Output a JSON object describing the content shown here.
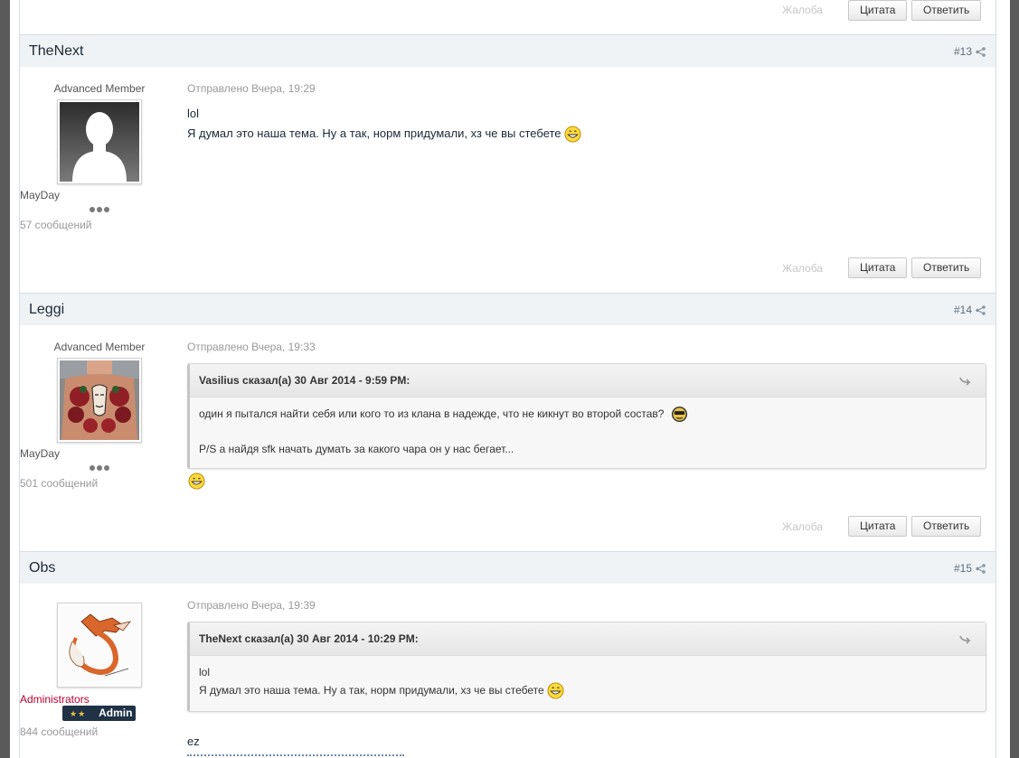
{
  "common": {
    "report_label": "Жалоба",
    "quote_label": "Цитата",
    "reply_label": "Ответить"
  },
  "posts": [
    {
      "author": "TheNext",
      "number": "#13",
      "group": "Advanced Member",
      "title": "MayDay",
      "count": "57 сообщений",
      "posted": "Отправлено Вчера, 19:29",
      "lines": [
        "lol",
        "Я думал это наша тема. Ну а так, норм придумали, хз че вы стебете"
      ]
    },
    {
      "author": "Leggi",
      "number": "#14",
      "group": "Advanced Member",
      "title": "MayDay",
      "count": "501 сообщений",
      "posted": "Отправлено Вчера, 19:33",
      "quote": {
        "cite": "Vasilius сказал(а) 30 Авг 2014 - 9:59 PM:",
        "line1": "один я пытался найти себя или кого то из клана в надежде, что не кикнут во второй состав?",
        "line2": "P/S а найдя sfk начать думать за какого чара он у нас бегает..."
      }
    },
    {
      "author": "Obs",
      "number": "#15",
      "group": "Administrators",
      "badge": "Admin",
      "count": "844 сообщений",
      "posted": "Отправлено Вчера, 19:39",
      "quote": {
        "cite": "TheNext сказал(а) 30 Авг 2014 - 10:29 PM:",
        "line1": "lol",
        "line2": "Я думал это наша тема. Ну а так, норм придумали, хз че вы стебете"
      },
      "reply_text": "ez"
    }
  ],
  "colors": {
    "header_bg": "#eff3f6",
    "admin_group": "#b8002f",
    "admin_badge": "#1f3246"
  }
}
